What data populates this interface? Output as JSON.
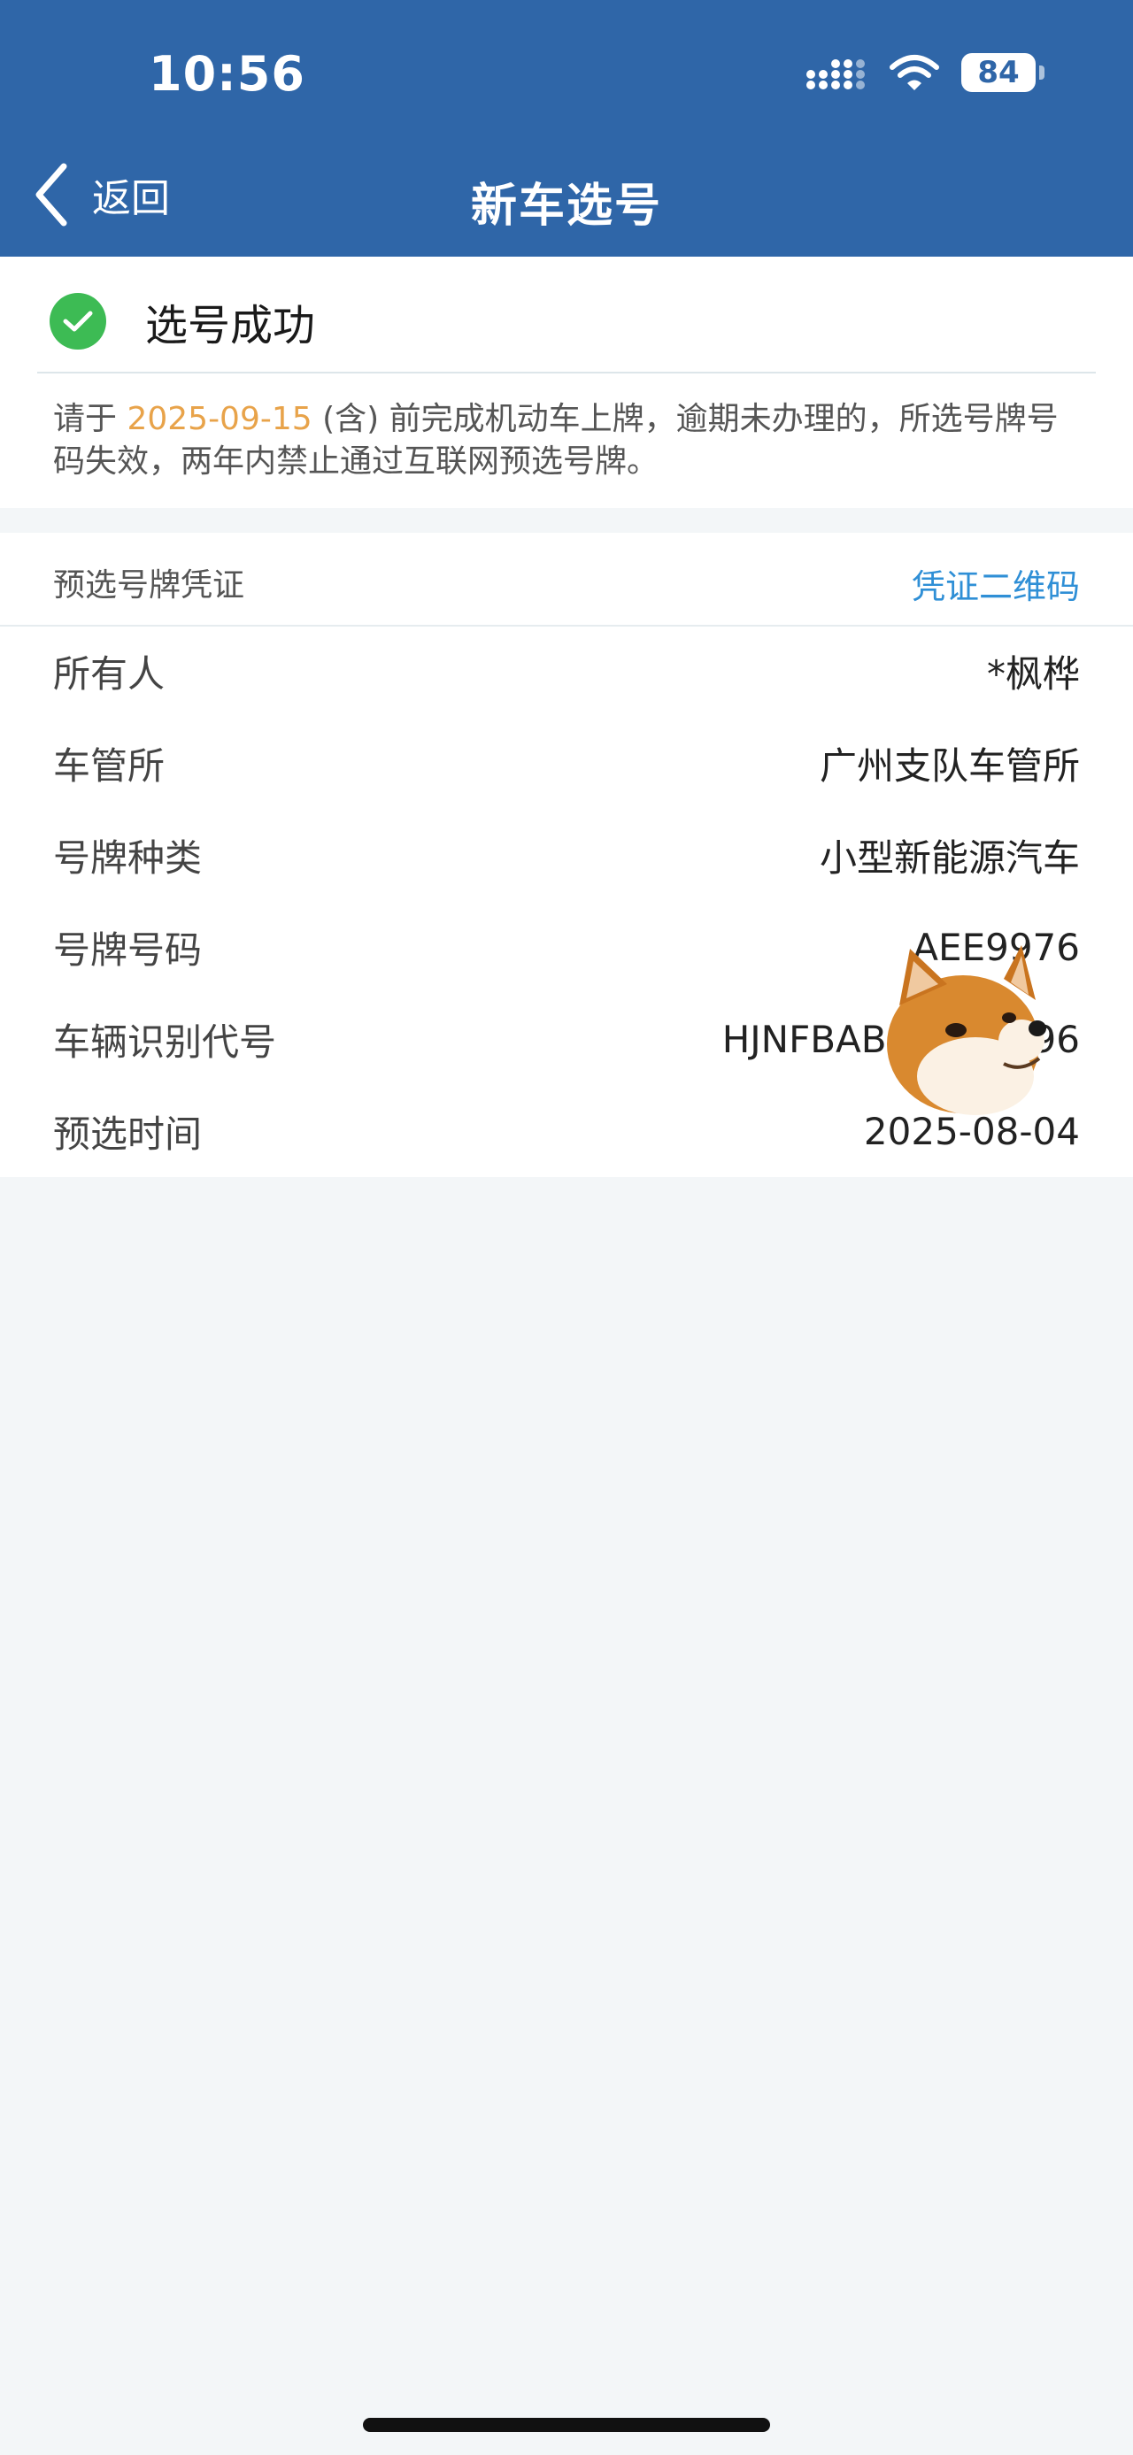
{
  "status_bar": {
    "time": "10:56",
    "battery": "84"
  },
  "nav": {
    "back_label": "返回",
    "title": "新车选号"
  },
  "success": {
    "title": "选号成功",
    "notice_prefix": "请于 ",
    "notice_date": "2025-09-15",
    "notice_suffix": " (含) 前完成机动车上牌，逾期未办理的，所选号牌号码失效，两年内禁止通过互联网预选号牌。"
  },
  "certificate": {
    "title": "预选号牌凭证",
    "qr_link": "凭证二维码",
    "rows": [
      {
        "label": "所有人",
        "value": "*枫桦"
      },
      {
        "label": "车管所",
        "value": "广州支队车管所"
      },
      {
        "label": "号牌种类",
        "value": "小型新能源汽车"
      },
      {
        "label": "号牌号码",
        "value": "AEE9976"
      },
      {
        "label": "车辆识别代号",
        "value": "HJNFBABN4        96"
      },
      {
        "label": "预选时间",
        "value": "2025-08-04"
      }
    ]
  },
  "colors": {
    "header_bg": "#2f66a8",
    "success_green": "#3dbb54",
    "date_orange": "#e8a34a",
    "link_blue": "#2f8fd6"
  }
}
